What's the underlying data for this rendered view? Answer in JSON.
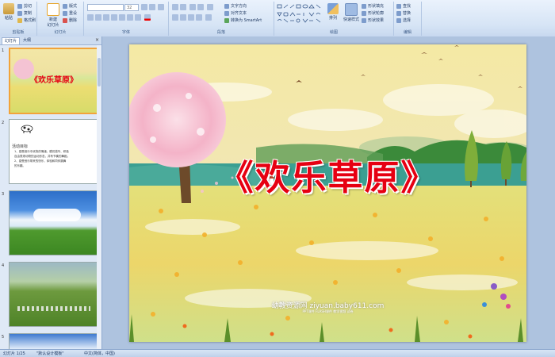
{
  "ribbon": {
    "clipboard": {
      "label": "剪贴板",
      "paste": "粘贴",
      "cut": "剪切",
      "copy": "复制",
      "format_painter": "格式刷"
    },
    "slides": {
      "label": "幻灯片",
      "new_slide": "新建\n幻灯片",
      "layout": "版式",
      "reset": "重设",
      "delete": "删除"
    },
    "font": {
      "label": "字体",
      "font_name": "",
      "font_size": "32"
    },
    "paragraph": {
      "label": "段落",
      "text_direction": "文字方向",
      "align_text": "对齐文本",
      "convert_smartart": "转换为 SmartArt"
    },
    "drawing": {
      "label": "绘图",
      "arrange": "排列",
      "quick_styles": "快速样式",
      "shape_fill": "形状填充",
      "shape_outline": "形状轮廓",
      "shape_effects": "形状效果"
    },
    "editing": {
      "label": "编辑",
      "find": "查找",
      "replace": "替换",
      "select": "选择"
    }
  },
  "left_pane": {
    "tabs": [
      "幻灯片",
      "大纲"
    ],
    "close": "×",
    "thumbnails": [
      {
        "num": "1",
        "title": "《欢乐草原》"
      },
      {
        "num": "2",
        "heading": "活动目标",
        "lines": [
          "1、感受音乐中欢快的情绪，模仿描写、积极",
          "自由表现动物的运动形态，并有节奏的舞蹈。",
          "2、感受音乐带来的快乐，体验和同伴跳舞",
          "的乐趣。"
        ]
      },
      {
        "num": "3"
      },
      {
        "num": "4"
      },
      {
        "num": "5"
      }
    ]
  },
  "slide": {
    "title": "《欢乐草原》",
    "watermark": "幼教资源网 ziyuan.baby611.com",
    "watermark_small": "PPT课件 FLASH课件 教学视频 试卷"
  },
  "status_bar": {
    "slide_counter": "幻灯片 1/25",
    "theme": "\"默认设计模板\"",
    "language": "中文(简体，中国)"
  }
}
